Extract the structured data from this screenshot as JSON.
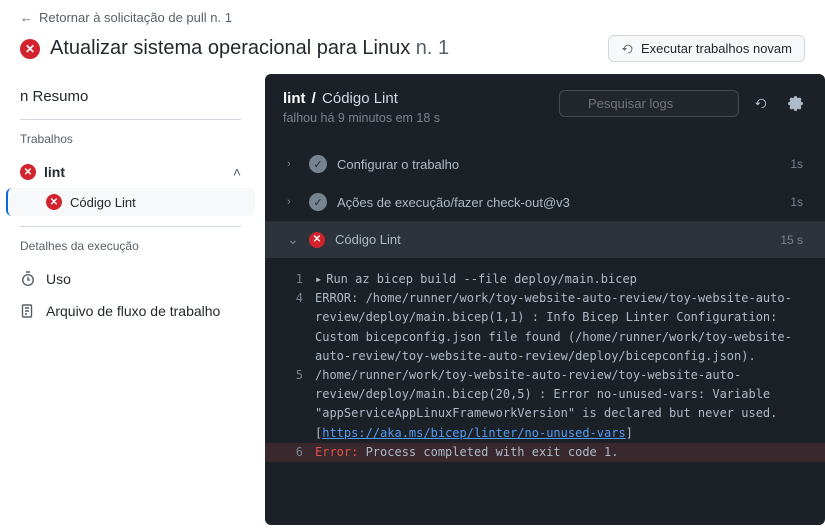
{
  "back_label": "Retornar à solicitação de pull n. 1",
  "title": "Atualizar sistema operacional para Linux",
  "title_suffix": "n. 1",
  "rerun_label": "Executar trabalhos novam",
  "sidebar": {
    "summary_label": "n Resumo",
    "jobs_caption": "Trabalhos",
    "job": {
      "name": "lint",
      "step_name": "Código Lint"
    },
    "details_caption": "Detalhes da execução",
    "usage_label": "Uso",
    "workflow_file_label": "Arquivo de fluxo de trabalho"
  },
  "log": {
    "bc_job": "lint",
    "bc_step": "Código Lint",
    "sub": "falhou há 9 minutos em 18 s",
    "search_placeholder": "Pesquisar logs",
    "steps": [
      {
        "name": "Configurar o trabalho",
        "time": "1s",
        "status": "ok"
      },
      {
        "name": "Ações de execução/fazer check-out@v3",
        "time": "1s",
        "status": "ok"
      },
      {
        "name": "Código Lint",
        "time": "15 s",
        "status": "fail",
        "expanded": true
      }
    ],
    "lines": [
      {
        "n": "1",
        "kind": "cmd",
        "text": "Run az bicep build --file deploy/main.bicep"
      },
      {
        "n": "4",
        "kind": "plain",
        "text": "ERROR: /home/runner/work/toy-website-auto-review/toy-website-auto-review/deploy/main.bicep(1,1) : Info Bicep Linter Configuration: Custom bicepconfig.json file found (/home/runner/work/toy-website-auto-review/toy-website-auto-review/deploy/bicepconfig.json)."
      },
      {
        "n": "5",
        "kind": "link",
        "text_pre": "/home/runner/work/toy-website-auto-review/toy-website-auto-review/deploy/main.bicep(20,5) : Error no-unused-vars: Variable \"appServiceAppLinuxFrameworkVersion\" is declared but never used. [",
        "link": "https://aka.ms/bicep/linter/no-unused-vars",
        "text_post": "]"
      },
      {
        "n": "6",
        "kind": "error",
        "prefix": "Error:",
        "text": " Process completed with exit code 1."
      }
    ]
  }
}
